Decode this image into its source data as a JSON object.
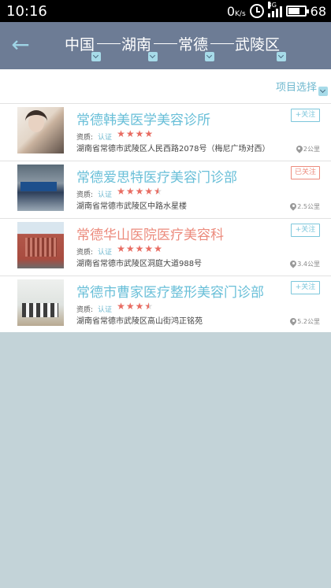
{
  "status_bar": {
    "time": "10:16",
    "net_speed": "0",
    "net_unit": "K/s",
    "signal_type": "3G",
    "battery": "68"
  },
  "header": {
    "back_icon": "arrow-left-icon",
    "regions": [
      "中国",
      "湖南",
      "常德",
      "武陵区"
    ]
  },
  "filter": {
    "label": "项目选择"
  },
  "clinics": [
    {
      "name": "常德韩美医学美容诊所",
      "qual_label": "资质:",
      "cert": "认证",
      "rating": 4,
      "stars": "★★★★",
      "address": "湖南省常德市武陵区人民西路2078号（梅尼广场对西）",
      "follow": "+关注",
      "followed": false,
      "distance": "2公里"
    },
    {
      "name": "常德爱思特医疗美容门诊部",
      "qual_label": "资质:",
      "cert": "认证",
      "rating": 4.5,
      "stars": "★★★★",
      "address": "湖南省常德市武陵区中路水星楼",
      "follow": "已关注",
      "followed": true,
      "distance": "2.5公里"
    },
    {
      "name": "常德华山医院医疗美容科",
      "qual_label": "资质:",
      "cert": "认证",
      "rating": 5,
      "stars": "★★★★★",
      "address": "湖南省常德市武陵区洞庭大道988号",
      "follow": "+关注",
      "followed": false,
      "distance": "3.4公里"
    },
    {
      "name": "常德市曹家医疗整形美容门诊部",
      "qual_label": "资质:",
      "cert": "认证",
      "rating": 3.5,
      "stars": "★★★",
      "address": "湖南省常德市武陵区高山街鸿正铭苑",
      "follow": "+关注",
      "followed": false,
      "distance": "5.2公里"
    }
  ],
  "colors": {
    "header_bg": "#6d7c95",
    "title_blue": "#69bfd8",
    "title_red": "#ec8b7d",
    "star_red": "#e86c62",
    "page_bg": "#c3d3d8"
  }
}
